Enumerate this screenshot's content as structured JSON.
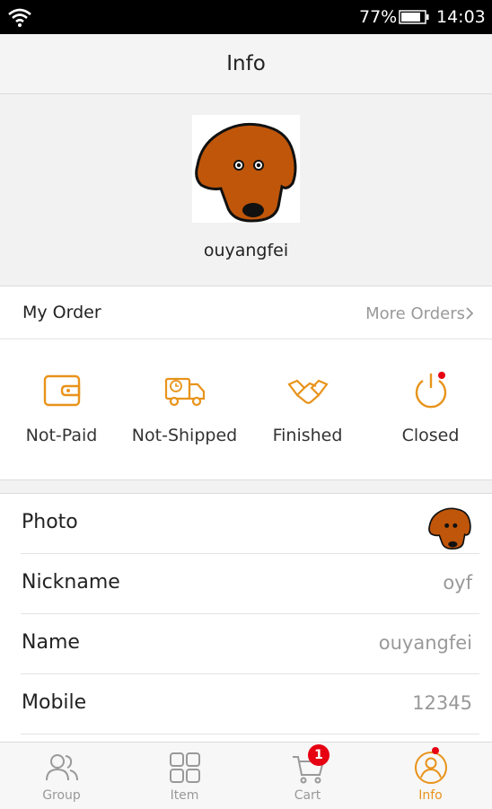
{
  "status_bar": {
    "battery_pct": "77%",
    "time": "14:03"
  },
  "header": {
    "title": "Info"
  },
  "profile": {
    "username": "ouyangfei"
  },
  "order": {
    "label": "My Order",
    "more_label": "More Orders",
    "statuses": [
      {
        "label": "Not-Paid",
        "icon": "wallet-icon"
      },
      {
        "label": "Not-Shipped",
        "icon": "truck-icon"
      },
      {
        "label": "Finished",
        "icon": "handshake-icon"
      },
      {
        "label": "Closed",
        "icon": "power-icon"
      }
    ]
  },
  "info": {
    "rows": [
      {
        "key": "Photo",
        "value": ""
      },
      {
        "key": "Nickname",
        "value": "oyf"
      },
      {
        "key": "Name",
        "value": "ouyangfei"
      },
      {
        "key": "Mobile",
        "value": "12345"
      }
    ]
  },
  "nav": {
    "items": [
      {
        "label": "Group",
        "icon": "group-icon"
      },
      {
        "label": "Item",
        "icon": "grid-icon"
      },
      {
        "label": "Cart",
        "icon": "cart-icon"
      },
      {
        "label": "Info",
        "icon": "profile-icon"
      }
    ],
    "cart_badge": "1"
  },
  "colors": {
    "accent": "#e8931a",
    "badge": "#e60012",
    "dog": "#c0560a"
  }
}
